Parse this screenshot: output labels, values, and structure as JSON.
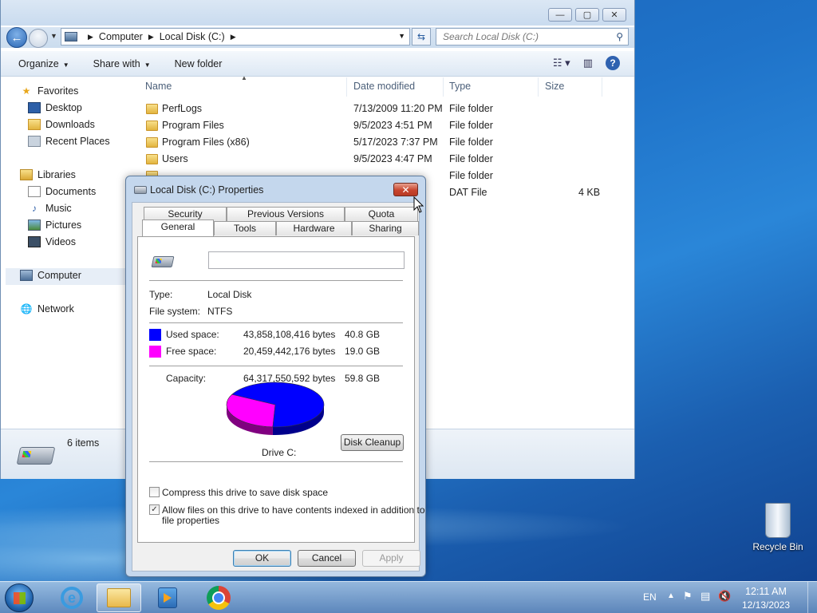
{
  "explorer": {
    "window_controls": {
      "minimize": "—",
      "maximize": "▢",
      "close": "✕"
    },
    "address": {
      "crumbs": [
        "Computer",
        "Local Disk (C:)"
      ]
    },
    "search": {
      "placeholder": "Search Local Disk (C:)"
    },
    "toolbar": {
      "organize": "Organize",
      "share_with": "Share with",
      "new_folder": "New folder"
    },
    "nav": {
      "favorites": "Favorites",
      "desktop": "Desktop",
      "downloads": "Downloads",
      "recent_places": "Recent Places",
      "libraries": "Libraries",
      "documents": "Documents",
      "music": "Music",
      "pictures": "Pictures",
      "videos": "Videos",
      "computer": "Computer",
      "network": "Network"
    },
    "columns": {
      "name": "Name",
      "date": "Date modified",
      "type": "Type",
      "size": "Size"
    },
    "files": [
      {
        "name": "PerfLogs",
        "date": "7/13/2009 11:20 PM",
        "type": "File folder",
        "size": ""
      },
      {
        "name": "Program Files",
        "date": "9/5/2023 4:51 PM",
        "type": "File folder",
        "size": ""
      },
      {
        "name": "Program Files (x86)",
        "date": "5/17/2023 7:37 PM",
        "type": "File folder",
        "size": ""
      },
      {
        "name": "Users",
        "date": "9/5/2023 4:47 PM",
        "type": "File folder",
        "size": ""
      },
      {
        "name": "",
        "date": "",
        "type": "File folder",
        "size": ""
      },
      {
        "name": "",
        "date": "",
        "type": "DAT File",
        "size": "4 KB"
      }
    ],
    "status": {
      "items": "6 items"
    }
  },
  "dialog": {
    "title": "Local Disk (C:) Properties",
    "close": "✕",
    "tabs_top": [
      "Security",
      "Previous Versions",
      "Quota"
    ],
    "tabs_bottom": [
      "General",
      "Tools",
      "Hardware",
      "Sharing"
    ],
    "active_tab": "General",
    "name_value": "",
    "type_label": "Type:",
    "type_value": "Local Disk",
    "fs_label": "File system:",
    "fs_value": "NTFS",
    "used_label": "Used space:",
    "used_bytes": "43,858,108,416 bytes",
    "used_gb": "40.8 GB",
    "free_label": "Free space:",
    "free_bytes": "20,459,442,176 bytes",
    "free_gb": "19.0 GB",
    "capacity_label": "Capacity:",
    "capacity_bytes": "64,317,550,592 bytes",
    "capacity_gb": "59.8 GB",
    "drive_label": "Drive C:",
    "disk_cleanup": "Disk Cleanup",
    "compress_label": "Compress this drive to save disk space",
    "compress_checked": false,
    "index_label_1": "Allow files on this drive to have contents indexed in addition to",
    "index_label_2": "file properties",
    "index_checked": true,
    "ok": "OK",
    "cancel": "Cancel",
    "apply": "Apply",
    "colors": {
      "used": "#0000ff",
      "free": "#ff00ff"
    },
    "used_fraction": 0.682
  },
  "desktop": {
    "recycle_bin": "Recycle Bin"
  },
  "taskbar": {
    "language": "EN",
    "time": "12:11 AM",
    "date": "12/13/2023"
  }
}
